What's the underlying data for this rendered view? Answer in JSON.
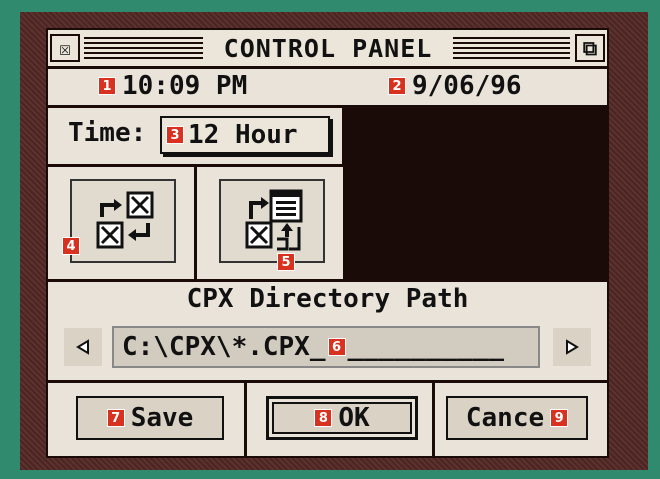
{
  "window": {
    "title": "CONTROL PANEL",
    "close_glyph": "☒",
    "full_glyph": "⧉"
  },
  "clock": {
    "time": "10:09 PM",
    "date": "9/06/96",
    "time_badge": "1",
    "date_badge": "2"
  },
  "time_format": {
    "label": "Time:",
    "value": "12 Hour",
    "badge": "3"
  },
  "icons": [
    {
      "name": "swap-cpx-icon",
      "badge": "4"
    },
    {
      "name": "load-cpx-icon",
      "badge": "5"
    }
  ],
  "cpx_path": {
    "title": "CPX Directory Path",
    "value": "C:\\CPX\\*.CPX_",
    "fill": "__________",
    "badge": "6",
    "left_arrow": "◆",
    "right_arrow": "◆"
  },
  "buttons": {
    "save": "Save",
    "save_badge": "7",
    "ok": "OK",
    "ok_badge": "8",
    "cancel": "Cance",
    "cancel_badge": "9"
  },
  "colors": {
    "background": "#2f8a6e",
    "frame": "#552a27",
    "panel": "#e9e3d9",
    "badge": "#d8311f"
  }
}
